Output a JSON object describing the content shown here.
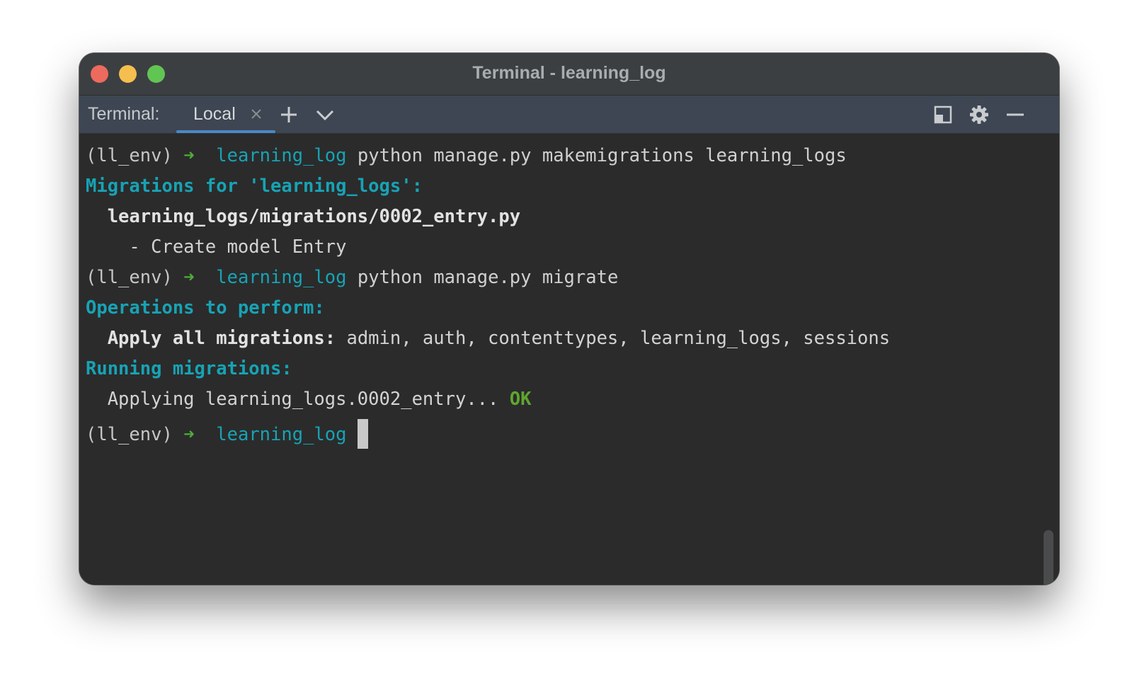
{
  "window": {
    "title": "Terminal - learning_log"
  },
  "toolbar": {
    "label": "Terminal:",
    "tab_label": "Local",
    "icons": [
      "close-icon",
      "plus-icon",
      "chevron-down-icon",
      "layout-icon",
      "gear-icon",
      "minimize-icon"
    ]
  },
  "colors": {
    "accent_tab": "#4a88c7",
    "prompt_arrow": "#4eac3b",
    "cyan_text": "#17a3b5",
    "ok": "#5fa52f",
    "background": "#2b2b2b"
  },
  "terminal": {
    "lines": [
      {
        "env": "(ll_env)",
        "arrow": "➜",
        "dir": "learning_log",
        "cmd": "python manage.py makemigrations learning_logs"
      },
      {
        "text": "Migrations for 'learning_logs':"
      },
      {
        "text": "  learning_logs/migrations/0002_entry.py"
      },
      {
        "text": "    - Create model Entry"
      },
      {
        "env": "(ll_env)",
        "arrow": "➜",
        "dir": "learning_log",
        "cmd": "python manage.py migrate"
      },
      {
        "text": "Operations to perform:"
      },
      {
        "bold": "  Apply all migrations:",
        "text": " admin, auth, contenttypes, learning_logs, sessions"
      },
      {
        "text": "Running migrations:"
      },
      {
        "text": "  Applying learning_logs.0002_entry... ",
        "ok": "OK"
      },
      {
        "env": "(ll_env)",
        "arrow": "➜",
        "dir": "learning_log",
        "cmd": ""
      }
    ]
  }
}
